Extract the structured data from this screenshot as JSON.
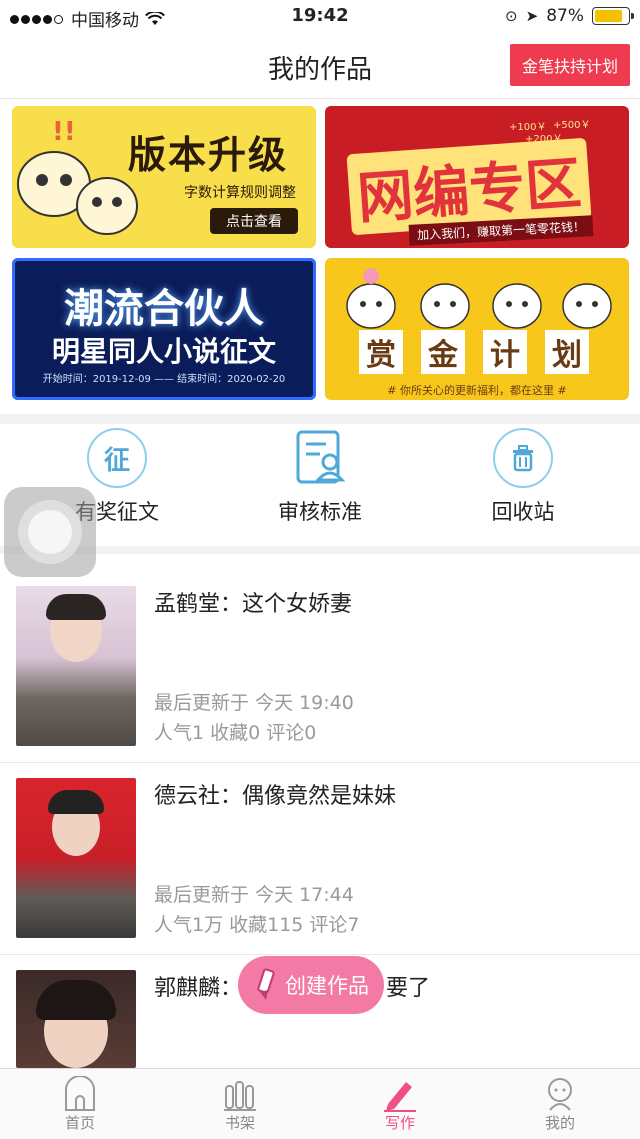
{
  "status": {
    "carrier": "中国移动",
    "time": "19:42",
    "battery": "87%"
  },
  "nav": {
    "title": "我的作品",
    "support_button": "金笔扶持计划"
  },
  "banners": [
    {
      "title": "版本升级",
      "subtitle": "字数计算规则调整",
      "cta": "点击查看"
    },
    {
      "title": "网编专区",
      "subtitle": "加入我们，赚取第一笔零花钱！",
      "bonus": [
        "+100￥",
        "+500￥",
        "+200￥"
      ]
    },
    {
      "title": "潮流合伙人",
      "subtitle": "明星同人小说征文",
      "dates": "开始时间：2019-12-09 —— 结束时间：2020-02-20"
    },
    {
      "chars": [
        "赏",
        "金",
        "计",
        "划"
      ],
      "subtitle": "# 你所关心的更新福利，都在这里 #"
    }
  ],
  "quick": [
    {
      "label": "有奖征文",
      "icon": "征"
    },
    {
      "label": "审核标准"
    },
    {
      "label": "回收站"
    }
  ],
  "works": [
    {
      "title": "孟鹤堂：这个女娇妻",
      "updated": "最后更新于 今天 19:40",
      "stats": "人气1 收藏0 评论0"
    },
    {
      "title": "德云社：偶像竟然是妹妹",
      "updated": "最后更新于 今天 17:44",
      "stats": "人气1万 收藏115 评论7"
    },
    {
      "title_left": "郭麒麟：",
      "title_right": "要了"
    }
  ],
  "create_button": "创建作品",
  "tabs": [
    "首页",
    "书架",
    "写作",
    "我的"
  ],
  "colors": {
    "accent": "#ef3b4f",
    "pink": "#f47aa6",
    "blue": "#4fa8d8"
  }
}
